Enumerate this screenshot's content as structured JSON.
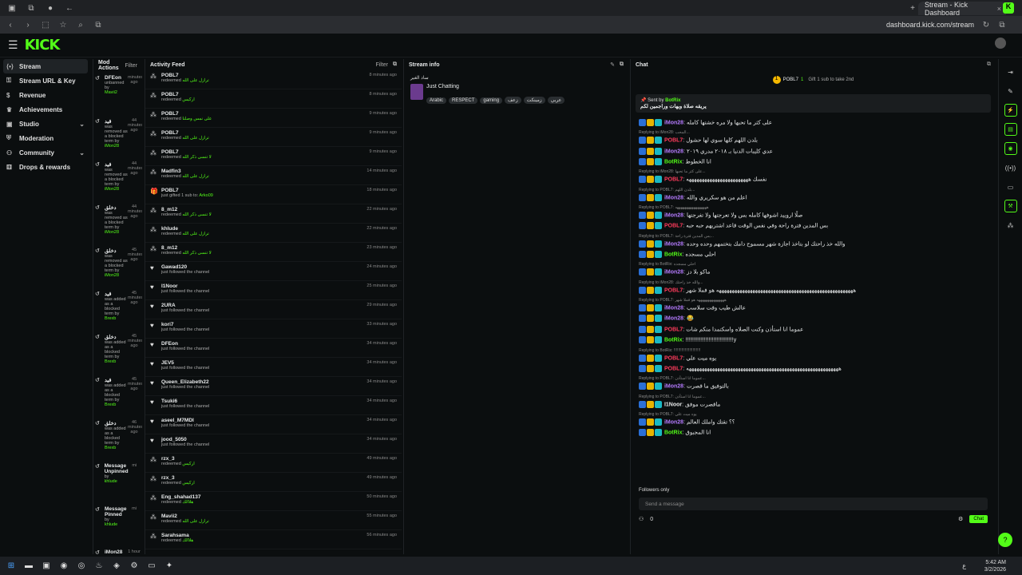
{
  "browser": {
    "tab_title": "Stream - Kick Dashboard",
    "url": "dashboard.kick.com/stream"
  },
  "header": {
    "logo": "KICK"
  },
  "sidenav": {
    "items": [
      {
        "label": "Stream",
        "icon": "stream-icon",
        "active": true
      },
      {
        "label": "Stream URL & Key",
        "icon": "key-icon"
      },
      {
        "label": "Revenue",
        "icon": "dollar-icon"
      },
      {
        "label": "Achievements",
        "icon": "trophy-icon"
      },
      {
        "label": "Studio",
        "icon": "studio-icon",
        "chevron": true
      },
      {
        "label": "Moderation",
        "icon": "shield-icon"
      },
      {
        "label": "Community",
        "icon": "users-icon",
        "chevron": true
      },
      {
        "label": "Drops & rewards",
        "icon": "gift-icon"
      }
    ]
  },
  "mod_actions": {
    "title": "Mod Actions",
    "filter": "Filter",
    "entries": [
      {
        "who": "DFEon",
        "action": "unbanned by",
        "by": "Mavii2",
        "time": "minutes ago"
      },
      {
        "who": "قيد",
        "action": "was removed as a blocked term by",
        "by": "iMon28",
        "time": "44 minutes ago"
      },
      {
        "who": "قيد",
        "action": "was removed as a blocked term by",
        "by": "iMon28",
        "time": "44 minutes ago"
      },
      {
        "who": "دخلق",
        "action": "was removed as a blocked term by",
        "by": "iMon28",
        "time": "44 minutes ago"
      },
      {
        "who": "دخلق",
        "action": "was removed as a blocked term by",
        "by": "iMon28",
        "time": "45 minutes ago"
      },
      {
        "who": "قيد",
        "action": "was added as a blocked term by",
        "by": "Brexb",
        "time": "45 minutes ago"
      },
      {
        "who": "دخلق",
        "action": "was added as a blocked term by",
        "by": "Brexb",
        "time": "45 minutes ago"
      },
      {
        "who": "قيد",
        "action": "was added as a blocked term by",
        "by": "Brexb",
        "time": "45 minutes ago"
      },
      {
        "who": "دخلق",
        "action": "was added as a blocked term by",
        "by": "Brexb",
        "time": "46 minutes ago"
      },
      {
        "who": "Message Unpinned",
        "action": "by",
        "by": "khlude",
        "time": "mi"
      },
      {
        "who": "Message Pinned",
        "action": "by",
        "by": "khlude",
        "time": "mi"
      },
      {
        "who": "iMon28",
        "action": "",
        "by": "",
        "time": "1 hour ago"
      }
    ]
  },
  "activity_feed": {
    "title": "Activity Feed",
    "filter": "Filter",
    "rows": [
      {
        "user": "POBL7",
        "action": "redeemed",
        "reward": "ترازل على الله",
        "time": "8 minutes ago",
        "icon": "reward-icon"
      },
      {
        "user": "POBL7",
        "action": "redeemed",
        "reward": "اركيس",
        "time": "8 minutes ago",
        "icon": "reward-icon"
      },
      {
        "user": "POBL7",
        "action": "redeemed",
        "reward": "على نمس وصلنا",
        "time": "9 minutes ago",
        "icon": "reward-icon"
      },
      {
        "user": "POBL7",
        "action": "redeemed",
        "reward": "ترازل على الله",
        "time": "9 minutes ago",
        "icon": "reward-icon"
      },
      {
        "user": "POBL7",
        "action": "redeemed",
        "reward": "لا تنسى ذكر الله",
        "time": "9 minutes ago",
        "icon": "reward-icon"
      },
      {
        "user": "Madfin3",
        "action": "redeemed",
        "reward": "ترازل على الله",
        "time": "14 minutes ago",
        "icon": "reward-icon"
      },
      {
        "user": "POBL7",
        "action": "just gifted 1 sub to:",
        "reward": "Arko09",
        "time": "18 minutes ago",
        "icon": "gift-icon"
      },
      {
        "user": "8_m12",
        "action": "redeemed",
        "reward": "لا تنسى ذكر الله",
        "time": "22 minutes ago",
        "icon": "reward-icon"
      },
      {
        "user": "khlude",
        "action": "redeemed",
        "reward": "ترازل على الله",
        "time": "22 minutes ago",
        "icon": "reward-icon"
      },
      {
        "user": "8_m12",
        "action": "redeemed",
        "reward": "لا تنسى ذكر الله",
        "time": "23 minutes ago",
        "icon": "reward-icon"
      },
      {
        "user": "Gawad120",
        "action": "just followed the channel",
        "reward": "",
        "time": "24 minutes ago",
        "icon": "heart-icon"
      },
      {
        "user": "I1Noor",
        "action": "just followed the channel",
        "reward": "",
        "time": "25 minutes ago",
        "icon": "heart-icon"
      },
      {
        "user": "2URA",
        "action": "just followed the channel",
        "reward": "",
        "time": "29 minutes ago",
        "icon": "heart-icon"
      },
      {
        "user": "kori7",
        "action": "just followed the channel",
        "reward": "",
        "time": "33 minutes ago",
        "icon": "heart-icon"
      },
      {
        "user": "DFEon",
        "action": "just followed the channel",
        "reward": "",
        "time": "34 minutes ago",
        "icon": "heart-icon"
      },
      {
        "user": "JEV5",
        "action": "just followed the channel",
        "reward": "",
        "time": "34 minutes ago",
        "icon": "heart-icon"
      },
      {
        "user": "Queen_Elizabeth22",
        "action": "just followed the channel",
        "reward": "",
        "time": "34 minutes ago",
        "icon": "heart-icon"
      },
      {
        "user": "Tsuki6",
        "action": "just followed the channel",
        "reward": "",
        "time": "34 minutes ago",
        "icon": "heart-icon"
      },
      {
        "user": "aseel_M7MDI",
        "action": "just followed the channel",
        "reward": "",
        "time": "34 minutes ago",
        "icon": "heart-icon"
      },
      {
        "user": "jood_5050",
        "action": "just followed the channel",
        "reward": "",
        "time": "34 minutes ago",
        "icon": "heart-icon"
      },
      {
        "user": "rzx_3",
        "action": "redeemed",
        "reward": "اركيس",
        "time": "49 minutes ago",
        "icon": "reward-icon"
      },
      {
        "user": "rzx_3",
        "action": "redeemed",
        "reward": "اركيس",
        "time": "49 minutes ago",
        "icon": "reward-icon"
      },
      {
        "user": "Eng_shahad137",
        "action": "redeemed",
        "reward": "هلاالك",
        "time": "50 minutes ago",
        "icon": "reward-icon"
      },
      {
        "user": "Mavii2",
        "action": "redeemed",
        "reward": "ترازل على الله",
        "time": "55 minutes ago",
        "icon": "reward-icon"
      },
      {
        "user": "Sarahsama",
        "action": "redeemed",
        "reward": "هلاالك",
        "time": "56 minutes ago",
        "icon": "reward-icon"
      }
    ]
  },
  "stream_info": {
    "title": "Stream info",
    "stream_title": "ساد الغير",
    "category": "Just Chatting",
    "tags": [
      "Arabic",
      "RESPECT",
      "gaming",
      "زعف",
      "زمينكت",
      "عربي"
    ]
  },
  "chat": {
    "title": "Chat",
    "top_gifter": {
      "name": "POBL7",
      "count": "1"
    },
    "gift_text": "Gift 1 sub to take 2nd",
    "pinned": {
      "sent_by": "Sent by",
      "bot": "BotRix",
      "text": "يريقه صلاة ويهات وراجمين لكم"
    },
    "messages": [
      {
        "reply": "",
        "user": "iMon28",
        "color": "#b57bff",
        "text": "على كثر ما تحبها ولا مره خشتها كامله"
      },
      {
        "reply": "Replying to iMon28: المحب...",
        "user": "POBL7",
        "color": "#ff3b5c",
        "text": "بلدن اللهم كلها سوي لها حشول"
      },
      {
        "reply": "",
        "user": "iMon28",
        "color": "#b57bff",
        "text": "عدي كليبات الدنيا بـ ٢٠١٨ مدري ٢٠١٩"
      },
      {
        "reply": "",
        "user": "BotRix",
        "color": "#53fc18",
        "text": "انا الخطوط"
      },
      {
        "reply": "Replying to iMon28: على كثر ما تحبها...",
        "user": "POBL7",
        "color": "#ff3b5c",
        "text": "نفسك ههههههههههههههههههههههههه"
      },
      {
        "reply": "Replying to POBL7: بلدن اللهم...",
        "user": "iMon28",
        "color": "#b57bff",
        "text": "اعلم من هو سكريري والله"
      },
      {
        "reply": "Replying to POBL7: هههههههههههههههههه",
        "user": "iMon28",
        "color": "#b57bff",
        "text": "صلًا اروييد اشوفها كامله بس ولا تعرجتها ولا تفرجتها"
      },
      {
        "reply": "",
        "user": "POBL7",
        "color": "#ff3b5c",
        "text": "بس المدين فترة راحة وفي نفس الوقت قاعد اشتريهم حبه حبه"
      },
      {
        "reply": "Replying to POBL7: بس المدين فترة راحة...",
        "user": "iMon28",
        "color": "#b57bff",
        "text": "والله خذ راحتك لو بتاخذ اجازة شهر مسموح دامك بتختمهم وحده وحده"
      },
      {
        "reply": "",
        "user": "BotRix",
        "color": "#53fc18",
        "text": "احلي مسجده"
      },
      {
        "reply": "Replying to BotRix: احلي مسجده",
        "user": "iMon28",
        "color": "#b57bff",
        "text": "ماكو بلا دز"
      },
      {
        "reply": "Replying to iMon28: والله خذ راحتك...",
        "user": "POBL7",
        "color": "#ff3b5c",
        "text": "هههههههههههههههههههههههههههههههههههههههههههههههههههههه هو فملا شهر"
      },
      {
        "reply": "Replying to POBL7: هههههههههههههههه هو فملا شهر",
        "user": "iMon28",
        "color": "#b57bff",
        "text": "عالش طيب وقت سلاسب"
      },
      {
        "reply": "",
        "user": "iMon28",
        "color": "#b57bff",
        "text": "😂"
      },
      {
        "reply": "",
        "user": "POBL7",
        "color": "#ff3b5c",
        "text": "عموما انا استأذن وكنت الصلاه واسكتمدا منكم شات"
      },
      {
        "reply": "",
        "user": "BotRix",
        "color": "#53fc18",
        "text": "!!!!!!!!!!!!!!!!!!!!!!!!!!!!!!!y"
      },
      {
        "reply": "Replying to BotRix: !!!!!!!!!!!!!!!!!!!!!!!!",
        "user": "POBL7",
        "color": "#ff3b5c",
        "text": "يوه ميت علي"
      },
      {
        "reply": "",
        "user": "POBL7",
        "color": "#ff3b5c",
        "text": "هههههههههههههههههههههههههههههههههههههههههههههههههههههههههههه"
      },
      {
        "reply": "Replying to POBL7: عموما انا استأذن...",
        "user": "iMon28",
        "color": "#b57bff",
        "text": "بالتوفيق ما قصرت"
      },
      {
        "reply": "Replying to POBL7: عموما انا استأذن...",
        "user": "I1Noor",
        "color": "#e7e9ea",
        "text": "ماقصرت موفق"
      },
      {
        "reply": "Replying to POBL7: يوه ميت علي",
        "user": "iMon28",
        "color": "#b57bff",
        "text": "؟؟ تقتك واملك العالم"
      },
      {
        "reply": "",
        "user": "BotRix",
        "color": "#53fc18",
        "text": "انا المجبوق"
      }
    ],
    "followers_only": "Followers only",
    "input_placeholder": "Send a message",
    "count": "0",
    "send_label": "Chat"
  },
  "taskbar": {
    "time": "5:42 AM",
    "date": "3/2/2026",
    "lang": "ع"
  },
  "colors": {
    "accent": "#53fc18",
    "bg": "#0b0e0f",
    "panel_border": "#1f2326"
  }
}
